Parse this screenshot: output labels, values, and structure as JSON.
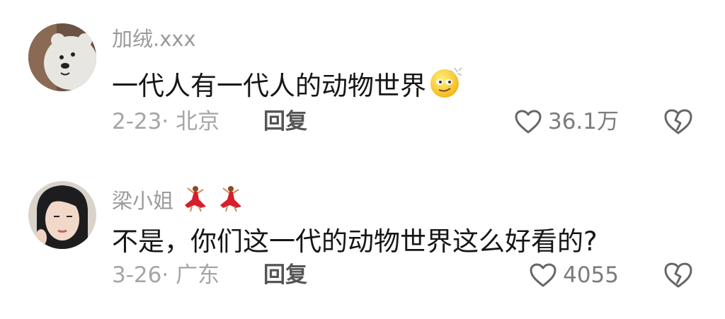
{
  "comments": [
    {
      "username": "加绒.xxx",
      "content": "一代人有一代人的动物世界",
      "content_emoji": "smirk-emoji",
      "date_location": "2-23· 北京",
      "reply_label": "回复",
      "like_count": "36.1万"
    },
    {
      "username": "梁小姐",
      "name_decorations": [
        "dancer-emoji",
        "dancer-emoji"
      ],
      "content": "不是，你们这一代的动物世界这么好看的?",
      "date_location": "3-26· 广东",
      "reply_label": "回复",
      "like_count": "4055"
    }
  ]
}
